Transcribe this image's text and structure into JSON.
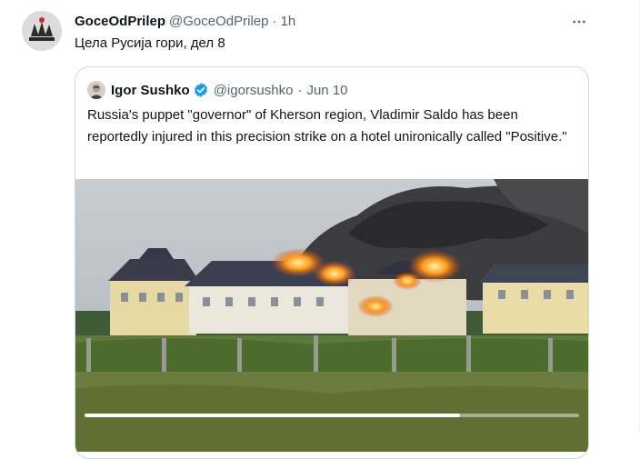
{
  "post": {
    "author_name": "GoceOdPrilep",
    "handle": "@GoceOdPrilep",
    "separator": "·",
    "time": "1h",
    "text": "Цела Русија гори, дел 8",
    "more_icon": "more-horizontal-icon"
  },
  "quoted_post": {
    "author_name": "Igor Sushko",
    "verified": true,
    "handle": "@igorsushko",
    "separator": "·",
    "date": "Jun 10",
    "text": "Russia's puppet \"governor\" of Kherson region, Vladimir Saldo has been reportedly injured in this precision strike on a hotel unironically called \"Positive.\"",
    "media": {
      "type": "video",
      "progress": 0.76
    }
  },
  "colors": {
    "text_primary": "#0f1419",
    "text_secondary": "#536471",
    "border": "#cfd9de",
    "verified_blue": "#1d9bf0"
  }
}
